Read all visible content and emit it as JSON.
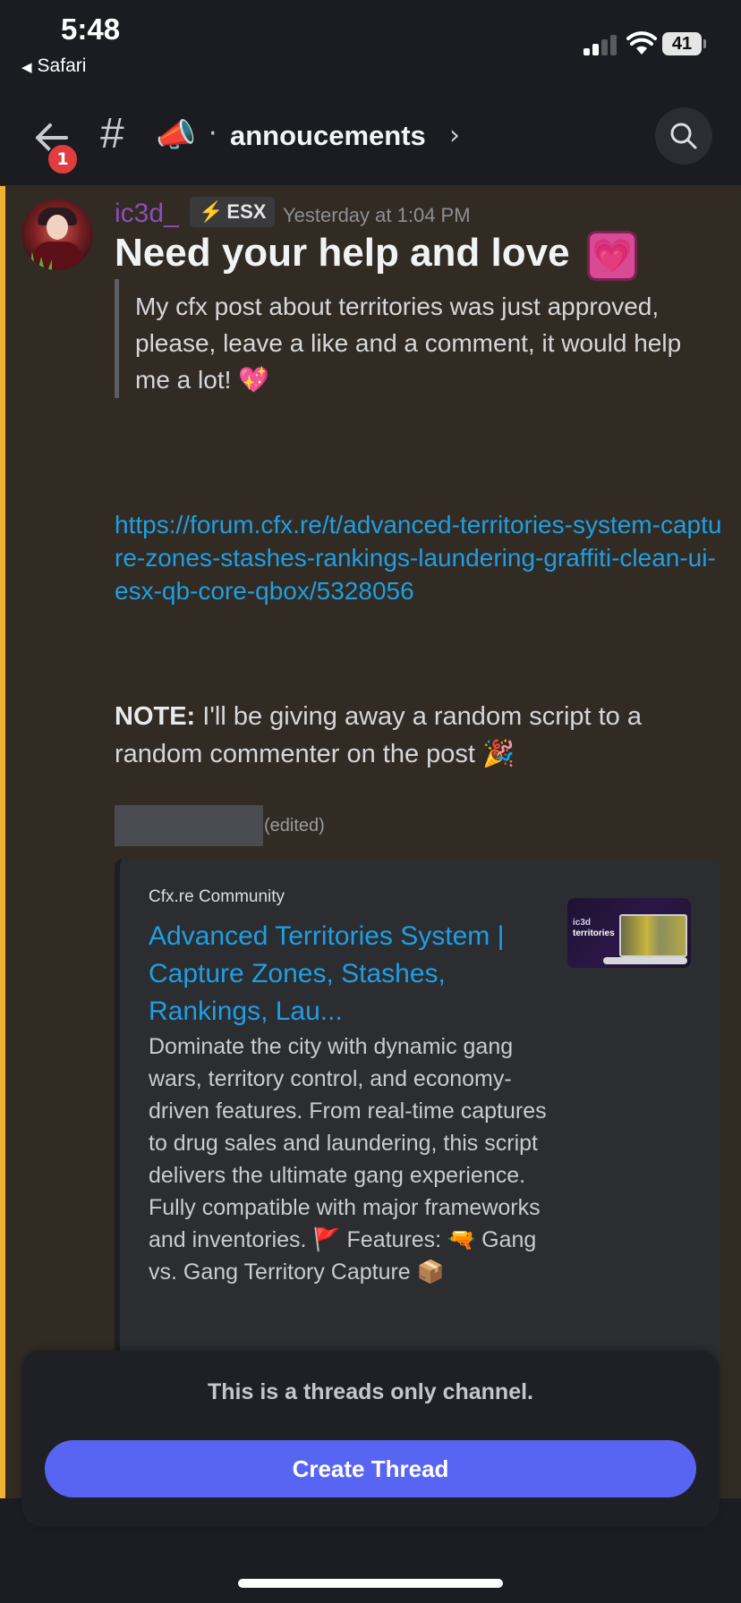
{
  "status_bar": {
    "time": "5:48",
    "back_app": "Safari",
    "battery": "41"
  },
  "channel_header": {
    "hash": "#",
    "emoji": "📣",
    "separator": "·",
    "name": "annoucements",
    "chevron": "›",
    "notification_count": "1"
  },
  "message": {
    "author": "ic3d_",
    "author_color": "#8a4fb6",
    "tag_icon": "⚡",
    "tag": "ESX",
    "timestamp": "Yesterday at 1:04 PM",
    "title": "Need your help and love",
    "title_emoji": "💗",
    "quote": "My cfx post about territories was just approved, please, leave a like and a comment, it would help me a lot! 💖",
    "link": "https://forum.cfx.re/t/advanced-territories-system-capture-zones-stashes-rankings-laundering-graffiti-clean-ui-esx-qb-core-qbox/5328056",
    "note_label": "NOTE:",
    "note_text": " I'll be giving away a random script to a random commenter on the post  🎉",
    "edited": "(edited)"
  },
  "embed": {
    "provider": "Cfx.re Community",
    "title": "Advanced Territories System | Capture Zones, Stashes, Rankings, Lau...",
    "description": "Dominate the city with dynamic gang wars, territory control, and economy-driven features. From real-time captures to drug sales and laundering, this script delivers the ultimate gang experience. Fully compatible with major frameworks and inventories.  🚩 Features:  🔫 Gang vs. Gang Territory Capture  📦",
    "thumbnail_line1": "ic3d",
    "thumbnail_line2": "territories"
  },
  "threads_panel": {
    "message": "This is a threads only channel.",
    "button": "Create Thread",
    "button_color": "#5865f2"
  },
  "colors": {
    "mention_bar": "#f0b232",
    "link": "#1e9fe3",
    "highlight_bg": "#312b24"
  }
}
